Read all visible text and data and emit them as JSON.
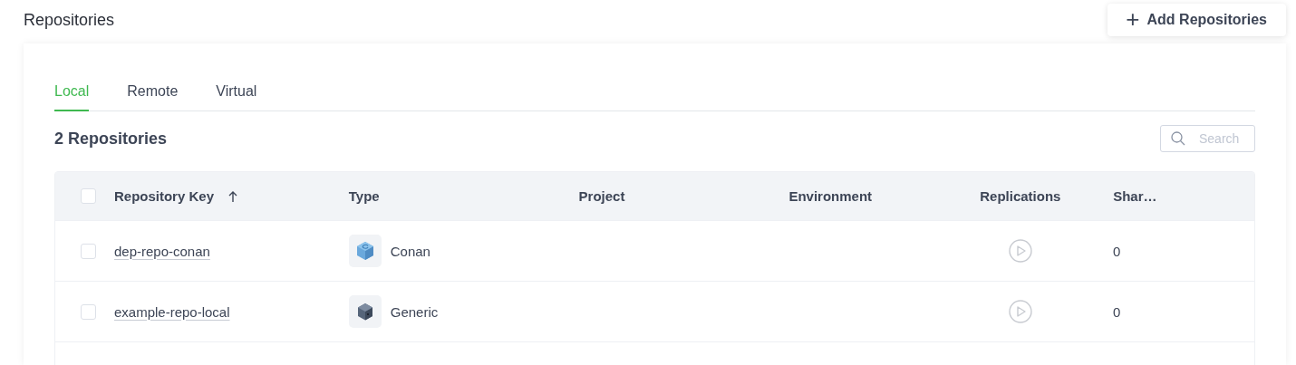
{
  "page": {
    "title": "Repositories"
  },
  "add_button": {
    "icon": "+",
    "label": "Add Repositories"
  },
  "tabs": [
    {
      "label": "Local",
      "selected": true
    },
    {
      "label": "Remote",
      "selected": false
    },
    {
      "label": "Virtual",
      "selected": false
    }
  ],
  "count": "2 Repositories",
  "search": {
    "placeholder": "Search"
  },
  "table": {
    "select_all": {
      "checked": false
    },
    "columns": [
      {
        "label": "Repository Key",
        "sorted": true
      },
      {
        "label": "Type",
        "sorted": false
      },
      {
        "label": "Project",
        "sorted": false
      },
      {
        "label": "Environment",
        "sorted": false
      },
      {
        "label": "Replications",
        "sorted": false
      },
      {
        "label": "Shar…",
        "sorted": false
      }
    ],
    "rows": [
      {
        "checked": false,
        "key": "dep-repo-conan",
        "kind": "conan",
        "type": "Conan",
        "shared": "0"
      },
      {
        "checked": false,
        "key": "example-repo-local",
        "kind": "generic",
        "type": "Generic",
        "shared": "0"
      }
    ]
  }
}
